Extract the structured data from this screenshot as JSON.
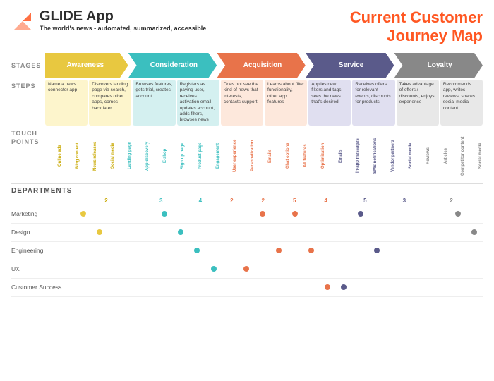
{
  "header": {
    "logo_title": "GLIDE App",
    "logo_subtitle_bold": "The world's news",
    "logo_subtitle_rest": " - automated, summarized, accessible",
    "page_title_line1": "Current Customer",
    "page_title_line2": "Journey Map"
  },
  "stages_label": "STAGES",
  "stages": [
    {
      "label": "Awareness",
      "class": "stage-awareness"
    },
    {
      "label": "Consideration",
      "class": "stage-consideration"
    },
    {
      "label": "Acquisition",
      "class": "stage-acquisition"
    },
    {
      "label": "Service",
      "class": "stage-service"
    },
    {
      "label": "Loyalty",
      "class": "stage-loyalty"
    }
  ],
  "steps_label": "STEPS",
  "steps": [
    {
      "text": "Name a news connector app",
      "bg": "awareness-bg"
    },
    {
      "text": "Discovers landing page via search, compares other apps, comes back later",
      "bg": "awareness-bg"
    },
    {
      "text": "Browses features, gets trial, creates account",
      "bg": "consideration-bg"
    },
    {
      "text": "Registers as paying user, receives activation email, updates account, adds filters, browses news",
      "bg": "consideration-bg"
    },
    {
      "text": "Does not see the kind of news that interests, contacts support",
      "bg": "acquisition-bg"
    },
    {
      "text": "Learns about filter functionality, other app features",
      "bg": "acquisition-bg"
    },
    {
      "text": "Applies new filters and tags, sees the news that's desired",
      "bg": "service-bg"
    },
    {
      "text": "Receives offers for relevant events, discounts for products",
      "bg": "service-bg"
    },
    {
      "text": "Takes advantage of offers / discounts, enjoys experience",
      "bg": "loyalty-bg"
    },
    {
      "text": "Recommends app, writes reviews, shares social media content",
      "bg": "loyalty-bg"
    }
  ],
  "touchpoints_label": "TOUCH POINTS",
  "touchpoints": [
    {
      "label": "Online ads",
      "color": "tp-awareness"
    },
    {
      "label": "Blog content",
      "color": "tp-awareness"
    },
    {
      "label": "News releases",
      "color": "tp-awareness"
    },
    {
      "label": "Social media",
      "color": "tp-awareness"
    },
    {
      "label": "Landing page",
      "color": "tp-consideration"
    },
    {
      "label": "App discovery",
      "color": "tp-consideration"
    },
    {
      "label": "E-shop",
      "color": "tp-consideration"
    },
    {
      "label": "Sign up page",
      "color": "tp-consideration"
    },
    {
      "label": "Product page",
      "color": "tp-consideration"
    },
    {
      "label": "Engagement",
      "color": "tp-consideration"
    },
    {
      "label": "User experience",
      "color": "tp-acquisition"
    },
    {
      "label": "Personalization",
      "color": "tp-acquisition"
    },
    {
      "label": "Emails",
      "color": "tp-acquisition"
    },
    {
      "label": "Chat options",
      "color": "tp-acquisition"
    },
    {
      "label": "All features",
      "color": "tp-acquisition"
    },
    {
      "label": "Optimization",
      "color": "tp-acquisition"
    },
    {
      "label": "Emails",
      "color": "tp-service"
    },
    {
      "label": "In-app messages",
      "color": "tp-service"
    },
    {
      "label": "SMS notifications",
      "color": "tp-service"
    },
    {
      "label": "Vendor partners",
      "color": "tp-service"
    },
    {
      "label": "Social media",
      "color": "tp-service"
    },
    {
      "label": "Reviews",
      "color": "tp-loyalty"
    },
    {
      "label": "Articles",
      "color": "tp-loyalty"
    },
    {
      "label": "Competitor content",
      "color": "tp-loyalty"
    },
    {
      "label": "Social media",
      "color": "tp-loyalty"
    }
  ],
  "departments_label": "DEPARTMENTS",
  "dept_counts": [
    {
      "label": "2",
      "color": "count-awareness"
    },
    {
      "label": "3",
      "color": "count-consideration"
    },
    {
      "label": "4",
      "color": "count-consideration"
    },
    {
      "label": "2",
      "color": "count-acquisition"
    },
    {
      "label": "2",
      "color": "count-acquisition"
    },
    {
      "label": "5",
      "color": "count-acquisition"
    },
    {
      "label": "4",
      "color": "count-acquisition"
    },
    {
      "label": "5",
      "color": "count-service"
    },
    {
      "label": "3",
      "color": "count-service"
    },
    {
      "label": "2",
      "color": "count-loyalty"
    }
  ],
  "departments": [
    {
      "name": "Marketing",
      "dots": [
        {
          "pos": 4,
          "color": "dot-awareness"
        },
        {
          "pos": 18,
          "color": "dot-consideration"
        },
        {
          "pos": 44,
          "color": "dot-acquisition"
        },
        {
          "pos": 62,
          "color": "dot-acquisition"
        },
        {
          "pos": 76,
          "color": "dot-service"
        },
        {
          "pos": 90,
          "color": "dot-loyalty"
        }
      ]
    },
    {
      "name": "Design",
      "dots": [
        {
          "pos": 2,
          "color": "dot-awareness"
        },
        {
          "pos": 22,
          "color": "dot-consideration"
        },
        {
          "pos": 96,
          "color": "dot-loyalty"
        }
      ]
    },
    {
      "name": "Engineering",
      "dots": [
        {
          "pos": 28,
          "color": "dot-consideration"
        },
        {
          "pos": 52,
          "color": "dot-acquisition"
        },
        {
          "pos": 56,
          "color": "dot-acquisition"
        },
        {
          "pos": 80,
          "color": "dot-service"
        }
      ]
    },
    {
      "name": "UX",
      "dots": [
        {
          "pos": 36,
          "color": "dot-consideration"
        },
        {
          "pos": 48,
          "color": "dot-acquisition"
        }
      ]
    },
    {
      "name": "Customer Success",
      "dots": [
        {
          "pos": 62,
          "color": "dot-acquisition"
        },
        {
          "pos": 70,
          "color": "dot-service"
        }
      ]
    }
  ]
}
